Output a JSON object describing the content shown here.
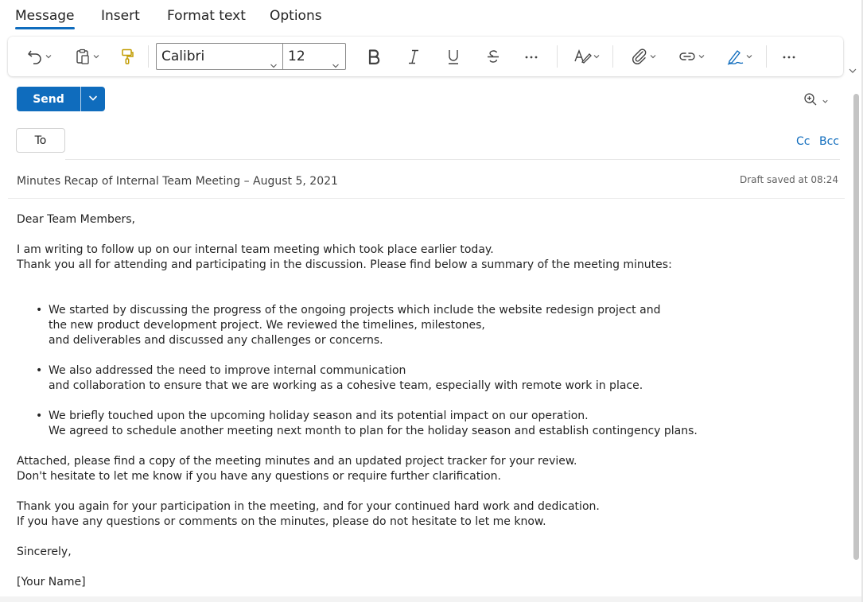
{
  "tabs": [
    {
      "label": "Message",
      "active": true
    },
    {
      "label": "Insert"
    },
    {
      "label": "Format text"
    },
    {
      "label": "Options"
    }
  ],
  "ribbon": {
    "font_name": "Calibri",
    "font_size": "12",
    "icons": [
      "undo-icon",
      "paste-icon",
      "format-painter-icon",
      "bold-icon",
      "italic-icon",
      "underline-icon",
      "strikethrough-icon",
      "more-icon",
      "styles-icon",
      "attach-icon",
      "link-icon",
      "signature-icon",
      "more-options-icon"
    ]
  },
  "send": {
    "label": "Send"
  },
  "accent_color": "#0f6cbd",
  "to": {
    "label": "To"
  },
  "cc": "Cc",
  "bcc": "Bcc",
  "subject": "Minutes Recap of Internal Team Meeting – August 5, 2021",
  "draft_status": "Draft saved at 08:24",
  "body": {
    "greeting": "Dear Team Members,",
    "p1_l1": "I am writing to follow up on our internal team meeting which took place earlier today.",
    "p1_l2": "Thank you all for attending and participating in the discussion. Please find below a summary of the meeting minutes:",
    "bullets": [
      {
        "l1": "We started by discussing the progress of the ongoing projects which include the website redesign project and",
        "l2": "the new product development project. We reviewed the timelines, milestones,",
        "l3": "and deliverables and discussed any challenges or concerns."
      },
      {
        "l1": "We also addressed the need to improve internal communication",
        "l2": "and collaboration to ensure that we are working as a cohesive team, especially with remote work in place."
      },
      {
        "l1": "We briefly touched upon the upcoming holiday season and its potential impact on our operation.",
        "l2": "We agreed to schedule another meeting next month to plan for the holiday season and establish contingency plans."
      }
    ],
    "p2_l1": "Attached, please find a copy of the meeting minutes and an updated project tracker for your review.",
    "p2_l2": "Don't hesitate to let me know if you have any questions or require further clarification.",
    "p3_l1": "Thank you again for your participation in the meeting, and for your continued hard work and dedication.",
    "p3_l2": "If you have any questions or comments on the minutes, please do not hesitate to let me know.",
    "closing": "Sincerely,",
    "signature": "[Your Name]"
  }
}
